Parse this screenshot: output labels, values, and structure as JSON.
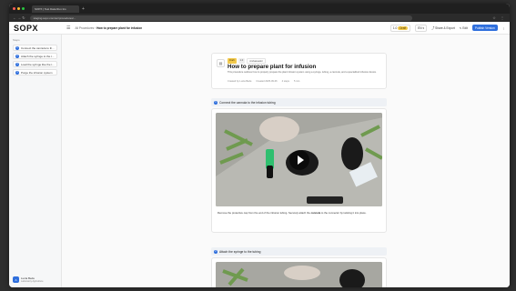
{
  "browser": {
    "tab_title": "SOPX | Test Data Run Ins",
    "url": "staging.sopx.com/en/procedures/..."
  },
  "app": {
    "logo": "SOPX",
    "breadcrumb_root": "All Procedures",
    "breadcrumb_current": "How to prepare plant for infusion",
    "header_chip_version": "1.0",
    "header_status": "Draft",
    "header_lang": "EN",
    "share_label": "Share & Export",
    "edit_label": "Edit",
    "publish_label": "Publish Version"
  },
  "sidebar": {
    "title": "Steps",
    "items": [
      {
        "num": "1",
        "label": "Connect the cannula to th..."
      },
      {
        "num": "2",
        "label": "Attach the syringe to the t..."
      },
      {
        "num": "3",
        "label": "Load the syringe like the t..."
      },
      {
        "num": "4",
        "label": "Purge the infusion system"
      }
    ],
    "user_initials": "A",
    "user_name": "Lucia Bede",
    "user_org": "Laboratory Agriculture"
  },
  "procedure": {
    "badge_status": "Draft",
    "badge_version": "1.0",
    "badge_type": "Ambassador",
    "title": "How to prepare plant for infusion",
    "description": "This procedure outlines how to properly prepare the plant infusion system using a syringe, tubing, a cannula, and a specialized infusion device.",
    "meta_author": "Created by Lucia Bede",
    "meta_date": "Created 2025-09-06",
    "meta_steps": "4 steps",
    "meta_time": "5 min"
  },
  "steps": [
    {
      "num": "1",
      "title": "Connect the cannula to the infusion tubing",
      "text_before": "Remove the protective cap from the end of the infusion tubing. Securely attach the ",
      "text_bold": "cannula",
      "text_after": " to the connector by twisting it into place."
    },
    {
      "num": "2",
      "title": "Attach the syringe to the tubing"
    }
  ],
  "colors": {
    "accent": "#2f6fdd",
    "badge_yellow": "#f2c94c"
  }
}
